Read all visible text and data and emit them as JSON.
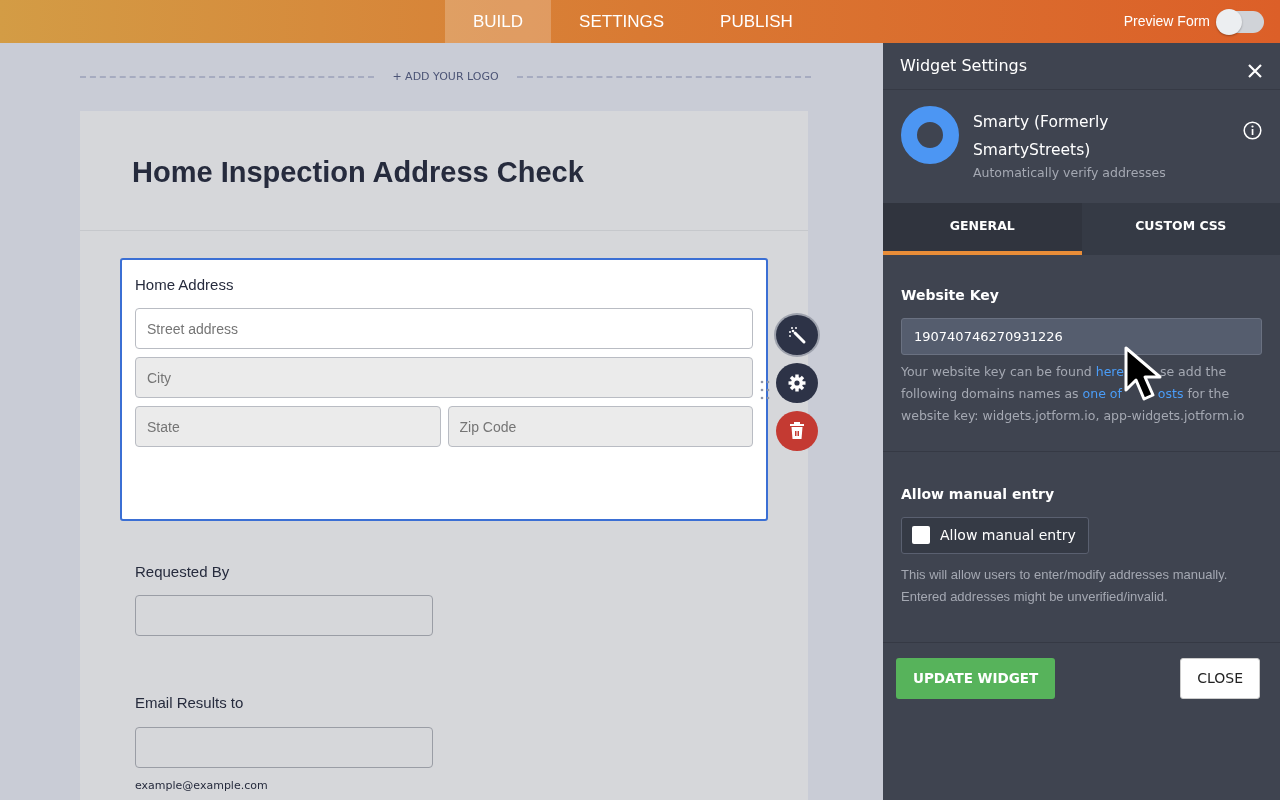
{
  "topbar": {
    "tabs": [
      {
        "label": "BUILD",
        "selected": true
      },
      {
        "label": "SETTINGS",
        "selected": false
      },
      {
        "label": "PUBLISH",
        "selected": false
      }
    ],
    "preview": {
      "label": "Preview Form",
      "on": false
    }
  },
  "canvas": {
    "add_logo": "+ ADD YOUR LOGO",
    "form_title": "Home Inspection Address Check",
    "fields": [
      {
        "kind": "address",
        "label": "Home Address",
        "selected": true,
        "inputs": [
          {
            "placeholder": "Street address",
            "disabled": false
          },
          {
            "placeholder": "City",
            "disabled": true
          },
          {
            "placeholder": "State",
            "disabled": true
          },
          {
            "placeholder": "Zip Code",
            "disabled": true
          }
        ]
      },
      {
        "kind": "text",
        "label": "Requested By",
        "selected": false
      },
      {
        "kind": "email",
        "label": "Email Results to",
        "selected": false,
        "hint": "example@example.com"
      }
    ]
  },
  "panel": {
    "title": "Widget Settings",
    "widget": {
      "name": "Smarty (Formerly SmartyStreets)",
      "description": "Automatically verify addresses"
    },
    "tabs": [
      {
        "label": "GENERAL",
        "selected": true
      },
      {
        "label": "CUSTOM CSS",
        "selected": false
      }
    ],
    "website_key": {
      "label": "Website Key",
      "value": "190740746270931226",
      "help": [
        {
          "kind": "text",
          "text": "Your website key can be found "
        },
        {
          "kind": "link",
          "text": "here"
        },
        {
          "kind": "covered"
        },
        {
          "kind": "text",
          "text": "se add the following domains names as "
        },
        {
          "kind": "link",
          "text": "one of"
        },
        {
          "kind": "covered"
        },
        {
          "kind": "link",
          "text": "osts"
        },
        {
          "kind": "text",
          "text": " for the website key: widgets.jotform.io, app-widgets.jotform.io"
        }
      ]
    },
    "manual_entry": {
      "title": "Allow manual entry",
      "checkbox": {
        "label": "Allow manual entry",
        "checked": false
      },
      "help": "This will allow users to enter/modify addresses manually. Entered addresses might be unverified/invalid."
    },
    "buttons": [
      {
        "kind": "primary",
        "label": "UPDATE WIDGET"
      },
      {
        "kind": "secondary",
        "label": "CLOSE"
      }
    ]
  }
}
